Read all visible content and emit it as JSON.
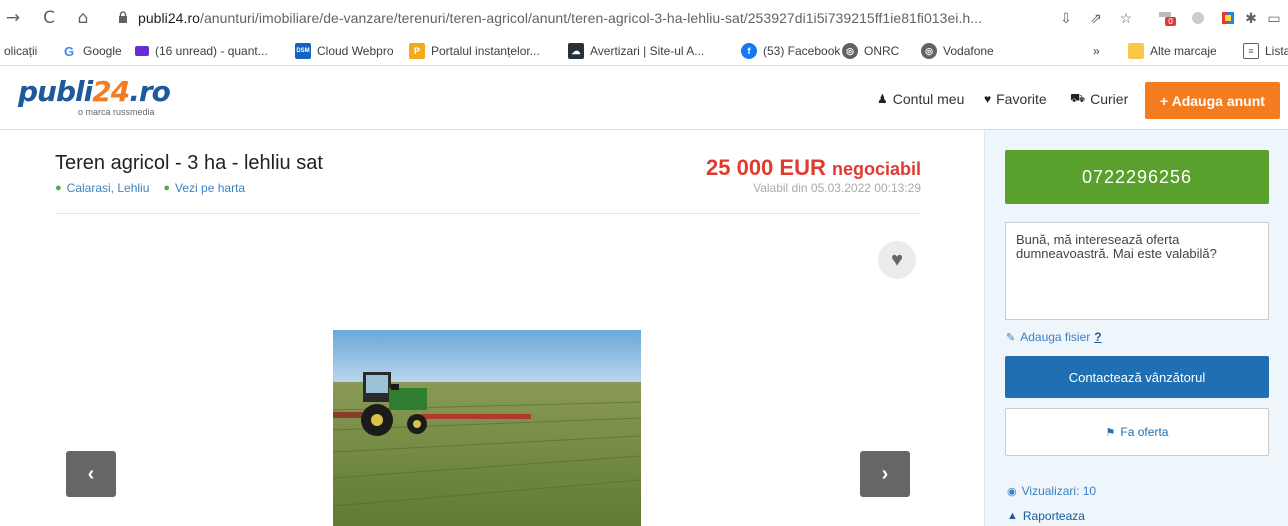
{
  "browser": {
    "url_main": "publi24.ro",
    "url_path": "/anunturi/imobiliare/de-vanzare/terenuri/teren-agricol/anunt/teren-agricol-3-ha-lehliu-sat/253927di1i5i739215ff1ie81fi013ei.h...",
    "bookmarks": [
      {
        "label": "olicații",
        "icon": "apps-icon"
      },
      {
        "label": "Google",
        "icon": "google-icon"
      },
      {
        "label": "(16 unread) - quant...",
        "icon": "mail-icon"
      },
      {
        "label": "Cloud Webpro",
        "icon": "dsm-icon"
      },
      {
        "label": "Portalul instanțelor...",
        "icon": "portal-icon"
      },
      {
        "label": "Avertizari | Site-ul A...",
        "icon": "weather-icon"
      },
      {
        "label": "(53) Facebook",
        "icon": "facebook-icon"
      },
      {
        "label": "ONRC",
        "icon": "globe-icon"
      },
      {
        "label": "Vodafone",
        "icon": "globe-icon"
      }
    ],
    "other_bookmarks": "Alte marcaje",
    "reading_list": "Lista",
    "overflow": "»"
  },
  "site": {
    "logo_text_a": "publi",
    "logo_text_num": "24",
    "logo_text_b": ".ro",
    "logo_sub": "o marca russmedia",
    "nav": {
      "account": "Contul meu",
      "favorites": "Favorite",
      "courier": "Curier",
      "add_ad": "+ Adauga anunt"
    }
  },
  "listing": {
    "title": "Teren agricol - 3 ha - lehliu sat",
    "location": "Calarasi, Lehliu",
    "map_link": "Vezi pe harta",
    "price": "25 000 EUR",
    "price_note": "negociabil",
    "valid_since": "Valabil din 05.03.2022 00:13:29"
  },
  "sidebar": {
    "phone": "0722296256",
    "message": "Bună, mă interesează oferta dumneavoastră. Mai este valabilă?",
    "attach_label": "Adauga fisier",
    "attach_help": "?",
    "contact_label": "Contactează vânzătorul",
    "offer_label": "Fa oferta",
    "views_label": "Vizualizari: 10",
    "report_label": "Raporteaza"
  },
  "colors": {
    "brand_blue": "#1c5a9c",
    "brand_orange": "#f47c20",
    "price_red": "#e03b2f",
    "phone_green": "#5aa02c",
    "contact_blue": "#1f6fb2"
  }
}
